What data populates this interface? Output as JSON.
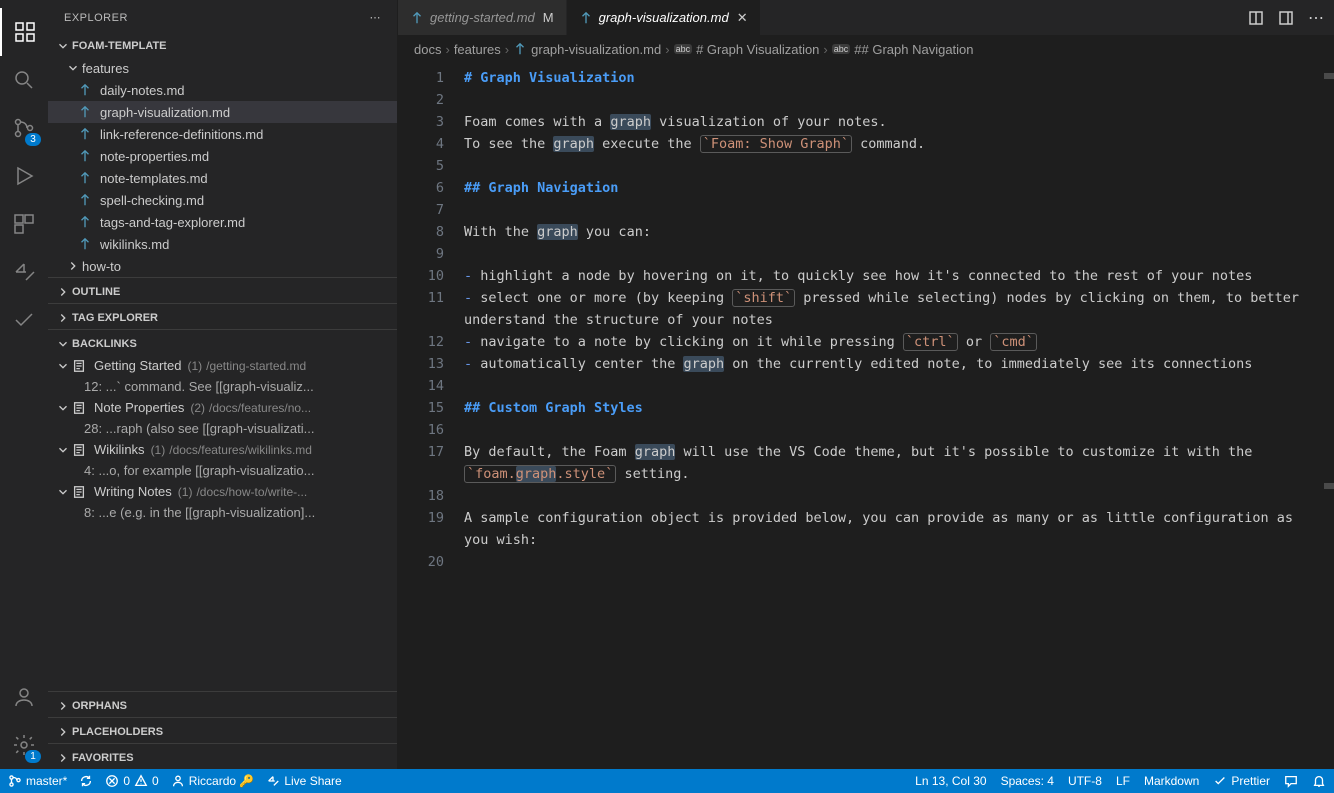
{
  "sidebar": {
    "title": "EXPLORER",
    "root": "FOAM-TEMPLATE",
    "folders": {
      "features": "features",
      "how_to": "how-to"
    },
    "files": [
      "daily-notes.md",
      "graph-visualization.md",
      "link-reference-definitions.md",
      "note-properties.md",
      "note-templates.md",
      "spell-checking.md",
      "tags-and-tag-explorer.md",
      "wikilinks.md"
    ],
    "sections": {
      "outline": "OUTLINE",
      "tag_explorer": "TAG EXPLORER",
      "backlinks": "BACKLINKS",
      "orphans": "ORPHANS",
      "placeholders": "PLACEHOLDERS",
      "favorites": "FAVORITES"
    },
    "backlinks": [
      {
        "title": "Getting Started",
        "count": "(1)",
        "path": "/getting-started.md",
        "excerpt": "12: ...` command. See [[graph-visualiz..."
      },
      {
        "title": "Note Properties",
        "count": "(2)",
        "path": "/docs/features/no...",
        "excerpt": "28: ...raph (also see [[graph-visualizati..."
      },
      {
        "title": "Wikilinks",
        "count": "(1)",
        "path": "/docs/features/wikilinks.md",
        "excerpt": "4: ...o, for example [[graph-visualizatio..."
      },
      {
        "title": "Writing Notes",
        "count": "(1)",
        "path": "/docs/how-to/write-...",
        "excerpt": "8: ...e (e.g. in the [[graph-visualization]..."
      }
    ]
  },
  "badges": {
    "scm": "3",
    "settings": "1"
  },
  "tabs": [
    {
      "name": "getting-started.md",
      "dirty": "M",
      "active": false
    },
    {
      "name": "graph-visualization.md",
      "dirty": "",
      "active": true
    }
  ],
  "breadcrumbs": [
    "docs",
    "features",
    "graph-visualization.md",
    "# Graph Visualization",
    "## Graph Navigation"
  ],
  "editor": {
    "lines": [
      {
        "n": "1",
        "type": "h1",
        "text": "# Graph Visualization"
      },
      {
        "n": "2",
        "type": "blank",
        "text": ""
      },
      {
        "n": "3",
        "type": "p",
        "segments": [
          "Foam comes with a ",
          {
            "hl": "graph"
          },
          " visualization of your notes."
        ]
      },
      {
        "n": "4",
        "type": "p",
        "segments": [
          "To see the ",
          {
            "hl": "graph"
          },
          " execute the ",
          {
            "code": "`Foam: Show Graph`",
            "boxed": true
          },
          " command."
        ]
      },
      {
        "n": "5",
        "type": "blank",
        "text": ""
      },
      {
        "n": "6",
        "type": "h2",
        "text": "## Graph Navigation"
      },
      {
        "n": "7",
        "type": "blank",
        "text": ""
      },
      {
        "n": "8",
        "type": "p",
        "segments": [
          "With the ",
          {
            "hl": "graph"
          },
          " you can:"
        ]
      },
      {
        "n": "9",
        "type": "blank",
        "text": ""
      },
      {
        "n": "10",
        "type": "li",
        "segments": [
          "highlight a node by hovering on it, to quickly see how it's connected to the rest of your notes"
        ]
      },
      {
        "n": "11",
        "type": "li",
        "segments": [
          "select one or more (by keeping ",
          {
            "code": "`shift`",
            "boxed": true
          },
          " pressed while selecting) nodes by clicking on them, to better understand the structure of your notes"
        ]
      },
      {
        "n": "12",
        "type": "li",
        "segments": [
          "navigate to a note by clicking on it while pressing ",
          {
            "code": "`ctrl`",
            "boxed": true
          },
          " or ",
          {
            "code": "`cmd`",
            "boxed": true
          }
        ]
      },
      {
        "n": "13",
        "type": "li",
        "segments": [
          "automatically center the ",
          {
            "hl": "graph"
          },
          " on the currently edited note, to immediately see its connections"
        ]
      },
      {
        "n": "14",
        "type": "blank",
        "text": ""
      },
      {
        "n": "15",
        "type": "h2",
        "text": "## Custom Graph Styles"
      },
      {
        "n": "16",
        "type": "blank",
        "text": ""
      },
      {
        "n": "17",
        "type": "p",
        "segments": [
          "By default, the Foam ",
          {
            "hl": "graph"
          },
          " will use the VS Code theme, but it's possible to customize it with the ",
          {
            "code": "`foam.graph.style`",
            "boxed": true,
            "hlpart": "graph"
          },
          " setting."
        ]
      },
      {
        "n": "18",
        "type": "blank",
        "text": ""
      },
      {
        "n": "19",
        "type": "p",
        "segments": [
          "A sample configuration object is provided below, you can provide as many or as little configuration as you wish:"
        ]
      },
      {
        "n": "20",
        "type": "blank",
        "text": ""
      }
    ]
  },
  "status": {
    "branch": "master*",
    "sync": "",
    "errors": "0",
    "warnings": "0",
    "user": "Riccardo 🔑",
    "liveshare": "Live Share",
    "position": "Ln 13, Col 30",
    "spaces": "Spaces: 4",
    "encoding": "UTF-8",
    "eol": "LF",
    "language": "Markdown",
    "prettier": "Prettier"
  }
}
